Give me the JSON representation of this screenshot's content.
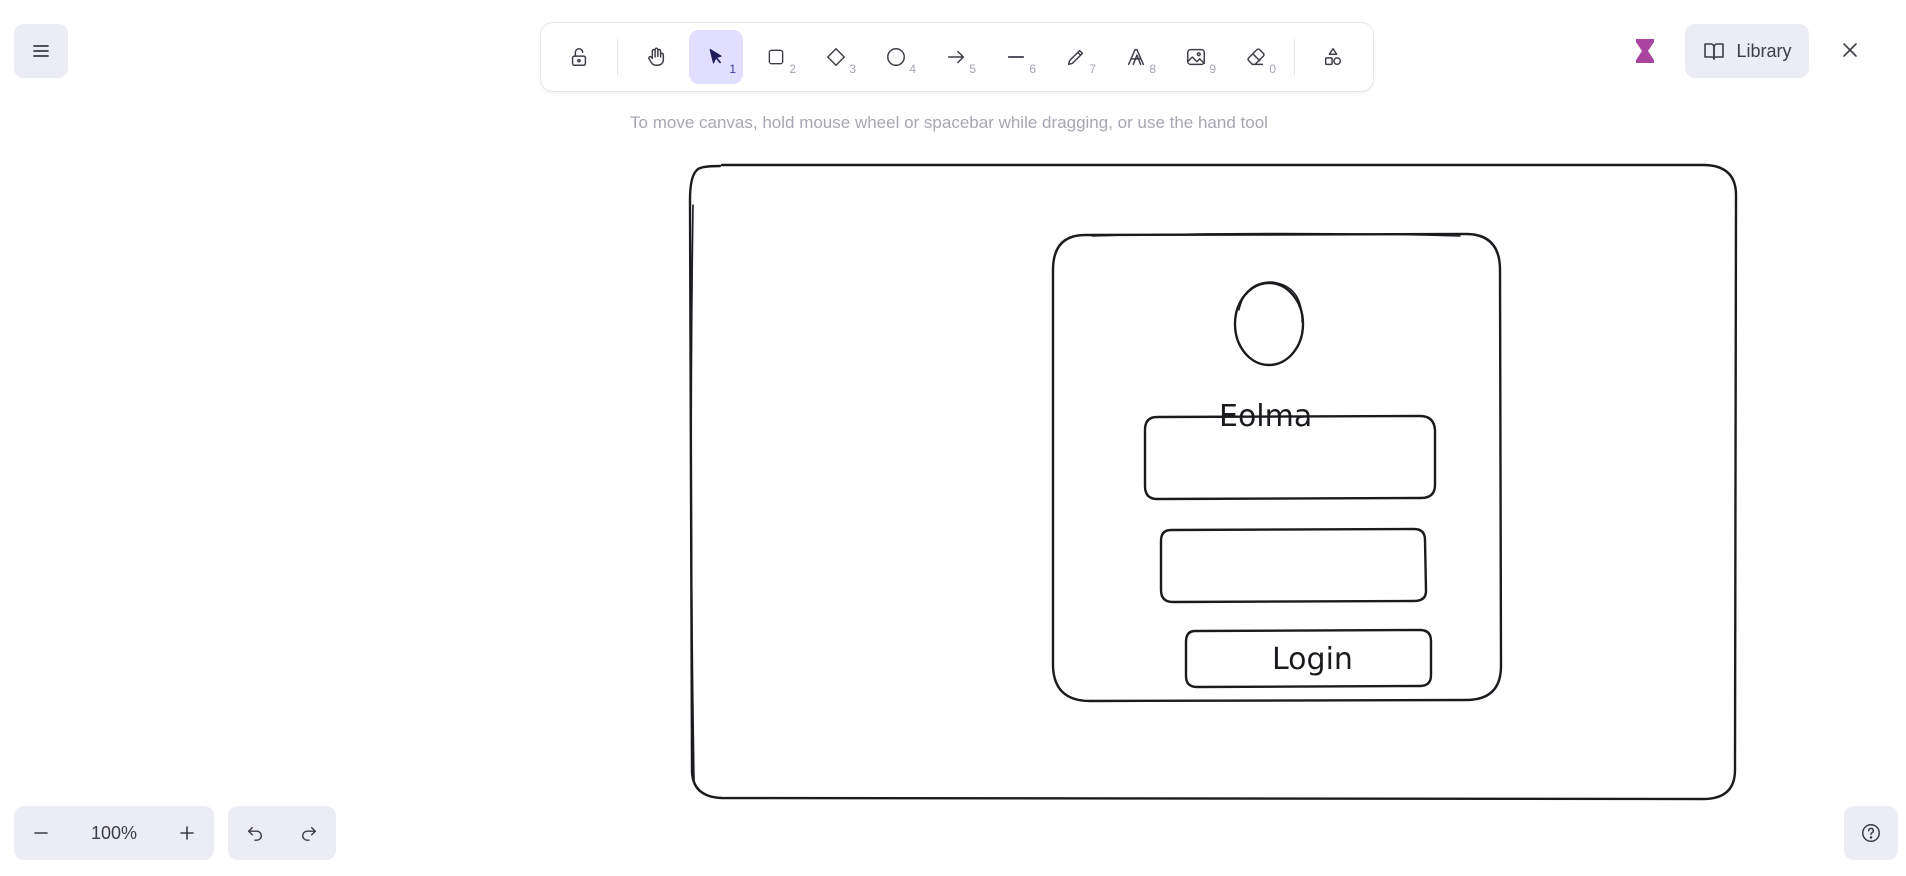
{
  "toolbar": {
    "tools": [
      {
        "id": "lock",
        "icon": "lock-open-icon",
        "key": ""
      },
      {
        "id": "hand",
        "icon": "hand-icon",
        "key": ""
      },
      {
        "id": "selection",
        "icon": "cursor-icon",
        "key": "1",
        "active": true
      },
      {
        "id": "rectangle",
        "icon": "square-icon",
        "key": "2"
      },
      {
        "id": "diamond",
        "icon": "diamond-icon",
        "key": "3"
      },
      {
        "id": "ellipse",
        "icon": "circle-icon",
        "key": "4"
      },
      {
        "id": "arrow",
        "icon": "arrow-right-icon",
        "key": "5"
      },
      {
        "id": "line",
        "icon": "line-icon",
        "key": "6"
      },
      {
        "id": "draw",
        "icon": "pencil-icon",
        "key": "7"
      },
      {
        "id": "text",
        "icon": "text-icon",
        "key": "8"
      },
      {
        "id": "image",
        "icon": "image-icon",
        "key": "9"
      },
      {
        "id": "eraser",
        "icon": "eraser-icon",
        "key": "0"
      },
      {
        "id": "extra",
        "icon": "shapes-icon",
        "key": ""
      }
    ],
    "active_color": "#e0dfff"
  },
  "hint": "To move canvas, hold mouse wheel or spacebar while dragging, or use the hand tool",
  "library": {
    "label": "Library"
  },
  "zoom": {
    "value": "100%"
  },
  "canvas": {
    "title_text": "Eolma",
    "button_text": "Login",
    "stroke_color": "#1b1b1f"
  },
  "colors": {
    "accent": "#e0dfff",
    "panel": "#ececf4",
    "brand": "#a9449f"
  }
}
